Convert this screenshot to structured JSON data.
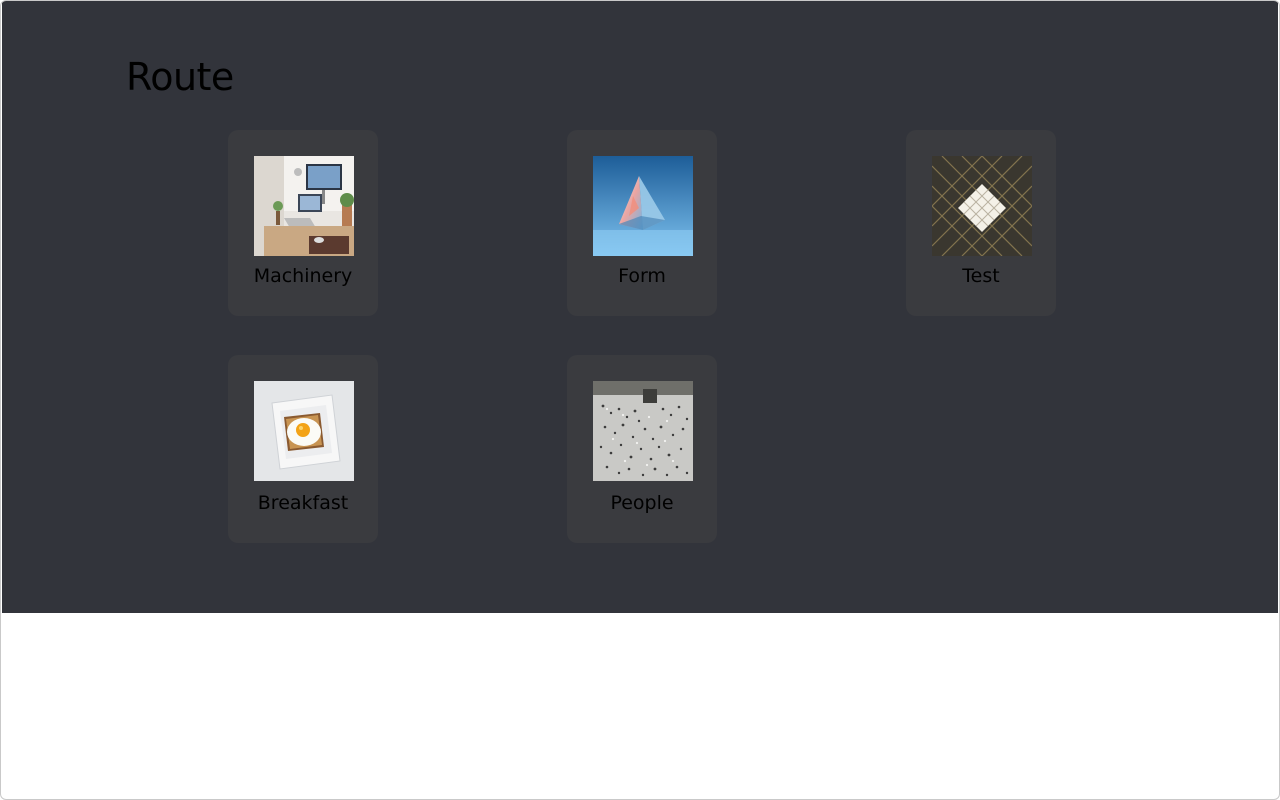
{
  "page": {
    "title": "Route"
  },
  "cards": [
    {
      "label": "Machinery",
      "icon": "desk-computer-photo"
    },
    {
      "label": "Form",
      "icon": "glass-prism-photo"
    },
    {
      "label": "Test",
      "icon": "light-grid-photo"
    },
    {
      "label": "Breakfast",
      "icon": "fried-egg-toast-photo"
    },
    {
      "label": "People",
      "icon": "crowd-plaza-photo"
    }
  ],
  "colors": {
    "panel": "#32343b",
    "card": "#3a3b3f",
    "text": "#000000"
  }
}
